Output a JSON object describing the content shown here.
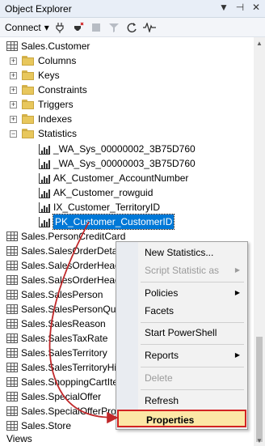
{
  "window": {
    "title": "Object Explorer",
    "controls": {
      "dropdown": "▼",
      "pin": "⊣",
      "close": "✕"
    }
  },
  "toolbar": {
    "connect_label": "Connect",
    "connect_arrow": "▾"
  },
  "tree": {
    "root_table": "Sales.Customer",
    "folders": [
      "Columns",
      "Keys",
      "Constraints",
      "Triggers",
      "Indexes",
      "Statistics"
    ],
    "statistics": [
      "_WA_Sys_00000002_3B75D760",
      "_WA_Sys_00000003_3B75D760",
      "AK_Customer_AccountNumber",
      "AK_Customer_rowguid",
      "IX_Customer_TerritoryID",
      "PK_Customer_CustomerID"
    ],
    "tables": [
      "Sales.PersonCreditCard",
      "Sales.SalesOrderDetail",
      "Sales.SalesOrderHeader",
      "Sales.SalesOrderHeaderSalesReason",
      "Sales.SalesPerson",
      "Sales.SalesPersonQuotaHistory",
      "Sales.SalesReason",
      "Sales.SalesTaxRate",
      "Sales.SalesTerritory",
      "Sales.SalesTerritoryHistory",
      "Sales.ShoppingCartItem",
      "Sales.SpecialOffer",
      "Sales.SpecialOfferProduct",
      "Sales.Store"
    ],
    "tables_visible": [
      "Sales.PersonCreditCard",
      "Sales.SalesOrderDetail",
      "Sales.SalesOrderHead",
      "Sales.SalesOrderHead",
      "Sales.SalesPerson",
      "Sales.SalesPersonQuo",
      "Sales.SalesReason",
      "Sales.SalesTaxRate",
      "Sales.SalesTerritory",
      "Sales.SalesTerritoryHis",
      "Sales.ShoppingCartIte",
      "Sales.SpecialOffer",
      "Sales.SpecialOfferProd",
      "Sales.Store"
    ],
    "bottom_folder": "Views"
  },
  "context_menu": {
    "items": [
      {
        "label": "New Statistics...",
        "enabled": true,
        "submenu": false
      },
      {
        "label": "Script Statistic as",
        "enabled": false,
        "submenu": true
      },
      {
        "label": "Policies",
        "enabled": true,
        "submenu": true
      },
      {
        "label": "Facets",
        "enabled": true,
        "submenu": false
      },
      {
        "label": "Start PowerShell",
        "enabled": true,
        "submenu": false
      },
      {
        "label": "Reports",
        "enabled": true,
        "submenu": true
      },
      {
        "label": "Delete",
        "enabled": false,
        "submenu": false
      },
      {
        "label": "Refresh",
        "enabled": true,
        "submenu": false
      },
      {
        "label": "Properties",
        "enabled": true,
        "submenu": false,
        "highlighted": true
      }
    ]
  },
  "colors": {
    "selection": "#0078d7",
    "highlight_border": "#d22323",
    "highlight_fill": "#fce7a6",
    "arrow": "#c0282a"
  }
}
